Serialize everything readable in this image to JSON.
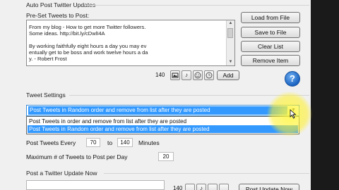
{
  "auto_post": {
    "group_title": "Auto Post Twitter Updates",
    "preset_label": "Pre-Set Tweets to Post:",
    "tweets_text": [
      "From my blog - How to get more Twitter followers.",
      "Some ideas. http://bit.ly/cDwlI4A",
      "",
      "By working faithfully eight hours a day you may ev",
      "entually get to be boss and work twelve hours a da",
      "y. - Robert Frost"
    ],
    "buttons": {
      "load": "Load from File",
      "save": "Save to File",
      "clear": "Clear List",
      "remove": "Remove Item"
    },
    "char_count": "140",
    "add_label": "Add",
    "icons": [
      "image-icon",
      "music-icon",
      "smiley-icon",
      "clock-icon"
    ]
  },
  "tweet_settings": {
    "group_title": "Tweet Settings",
    "order_selected": "Post Tweets in Random order and remove from list after they are posted",
    "order_options": [
      "Post Tweets in order and remove from list after they are posted",
      "Post Tweets in Random order and remove from list after they are posted"
    ],
    "post_every_label": "Post Tweets Every",
    "min_value": "70",
    "to_label": "to",
    "max_value": "140",
    "minutes_label": "Minutes",
    "max_per_day_label": "Maximum # of Tweets to Post per Day",
    "max_per_day_value": "20"
  },
  "post_now": {
    "group_title": "Post a Twitter Update Now",
    "char_count": "140",
    "button_label": "Post Update Now"
  },
  "colors": {
    "selection": "#3399ff",
    "highlight": "#fff23c",
    "help": "#1c64c2"
  }
}
